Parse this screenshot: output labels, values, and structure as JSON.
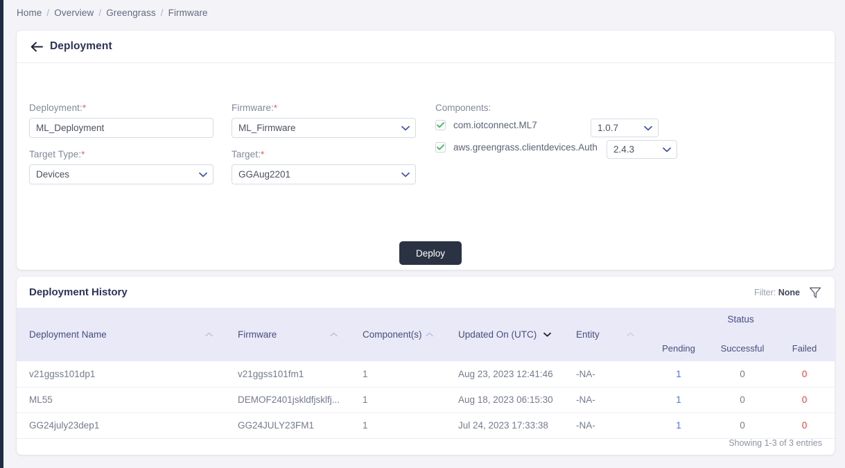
{
  "breadcrumb": {
    "items": [
      "Home",
      "Overview",
      "Greengrass",
      "Firmware"
    ],
    "separator": "/"
  },
  "deployment_card": {
    "title": "Deployment",
    "back_icon": "arrow-left-icon",
    "form": {
      "deployment": {
        "label": "Deployment:",
        "required": "*",
        "value": "ML_Deployment",
        "placeholder": ""
      },
      "firmware": {
        "label": "Firmware:",
        "required": "*",
        "value": "ML_Firmware"
      },
      "target_type": {
        "label": "Target Type:",
        "required": "*",
        "value": "Devices"
      },
      "target": {
        "label": "Target:",
        "required": "*",
        "value": "GGAug2201"
      }
    },
    "components": {
      "label": "Components:",
      "items": [
        {
          "name": "com.iotconnect.ML7",
          "checked": true,
          "version": "1.0.7"
        },
        {
          "name": "aws.greengrass.clientdevices.Auth",
          "checked": true,
          "version": "2.4.3"
        }
      ]
    },
    "deploy_button": "Deploy"
  },
  "history_card": {
    "title": "Deployment History",
    "filter_prefix": "Filter:",
    "filter_value": "None",
    "filter_icon": "funnel-icon",
    "columns": [
      {
        "label": "Deployment Name",
        "sort": "asc"
      },
      {
        "label": "Firmware",
        "sort": "asc"
      },
      {
        "label": "Component(s)",
        "sort": "asc"
      },
      {
        "label": "Updated On (UTC)",
        "sort": "desc"
      },
      {
        "label": "Entity",
        "sort": "asc"
      }
    ],
    "status_group": "Status",
    "status_columns": [
      "Pending",
      "Successful",
      "Failed"
    ],
    "rows": [
      {
        "name": "v21ggss101dp1",
        "firmware": "v21ggss101fm1",
        "components": "1",
        "updated": "Aug 23, 2023 12:41:46",
        "entity": "-NA-",
        "pending": "1",
        "successful": "0",
        "failed": "0"
      },
      {
        "name": "ML55",
        "firmware": "DEMOF2401jskldfjsklfj...",
        "components": "1",
        "updated": "Aug 18, 2023 06:15:30",
        "entity": "-NA-",
        "pending": "1",
        "successful": "0",
        "failed": "0"
      },
      {
        "name": "GG24july23dep1",
        "firmware": "GG24JULY23FM1",
        "components": "1",
        "updated": "Jul 24, 2023 17:33:38",
        "entity": "-NA-",
        "pending": "1",
        "successful": "0",
        "failed": "0"
      }
    ],
    "showing": "Showing 1-3 of 3 entries"
  },
  "colors": {
    "rail": "#212b42",
    "page_bg": "#f4f4f8",
    "accent": "#4e6ef0",
    "deploy_bg": "#2b3243",
    "table_header_bg": "#e9e9f8",
    "check_green": "#46b866",
    "fail_red": "#e0413a",
    "required_red": "#e0574f"
  }
}
